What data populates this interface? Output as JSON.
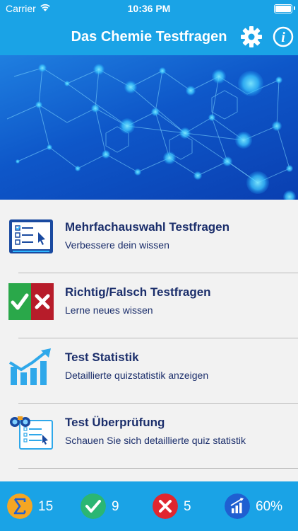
{
  "status_bar": {
    "carrier": "Carrier",
    "time": "10:36 PM"
  },
  "header": {
    "title": "Das Chemie Testfragen"
  },
  "menu": {
    "items": [
      {
        "title": "Mehrfachauswahl Testfragen",
        "subtitle": "Verbessere dein wissen",
        "icon": "multiple-choice-icon"
      },
      {
        "title": "Richtig/Falsch Testfragen",
        "subtitle": "Lerne neues wissen",
        "icon": "true-false-icon"
      },
      {
        "title": "Test Statistik",
        "subtitle": "Detaillierte quizstatistik anzeigen",
        "icon": "statistics-chart-icon"
      },
      {
        "title": "Test Überprüfung",
        "subtitle": "Schauen Sie sich detaillierte quiz statistik",
        "icon": "review-binoculars-icon"
      }
    ]
  },
  "stats": {
    "total": "15",
    "correct": "9",
    "wrong": "5",
    "percent": "60%"
  },
  "colors": {
    "primary": "#1aa3e6",
    "title_text": "#1b2e6b",
    "correct": "#2bb673",
    "wrong": "#e0262f",
    "sum": "#f5a623",
    "percent": "#1f5fd1"
  }
}
